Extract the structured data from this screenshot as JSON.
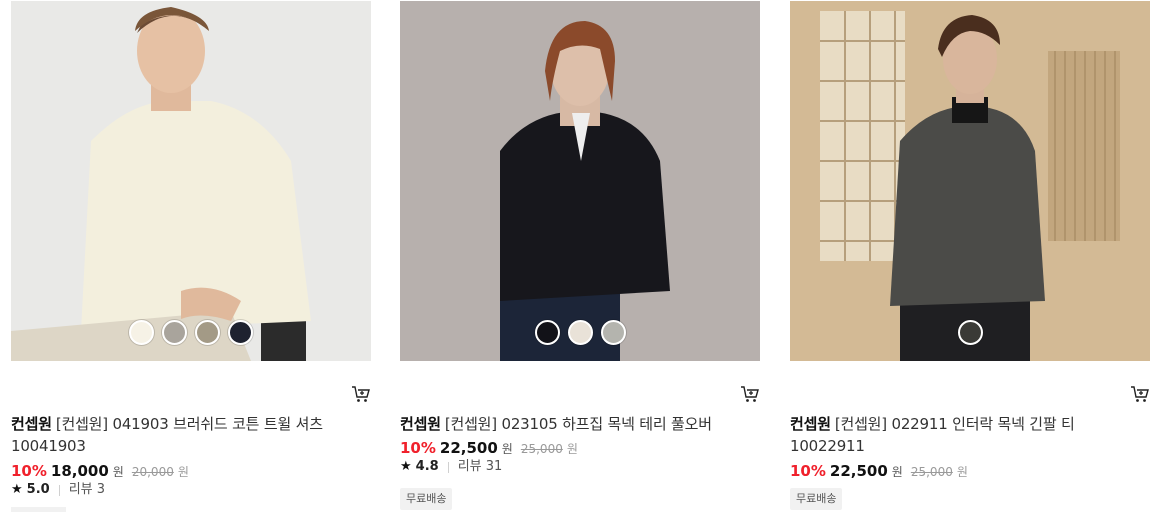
{
  "products": [
    {
      "brand": "컨셉원",
      "name": "[컨셉원] 041903 브러쉬드 코튼 트윌 셔츠 10041903",
      "discount": "10%",
      "price": "18,000",
      "unit": "원",
      "original_price": "20,000",
      "original_unit": "원",
      "rating": "5.0",
      "reviews": "리뷰 3",
      "badge": "",
      "swatches": [
        "#f6f2e6",
        "#a9a49c",
        "#a39a86",
        "#1e2230"
      ]
    },
    {
      "brand": "컨셉원",
      "name": "[컨셉원] 023105 하프집 목넥 테리 풀오버",
      "discount": "10%",
      "price": "22,500",
      "unit": "원",
      "original_price": "25,000",
      "original_unit": "원",
      "rating": "4.8",
      "reviews": "리뷰 31",
      "badge": "무료배송",
      "swatches": [
        "#121218",
        "#e9e2d8",
        "#b4b4ae"
      ]
    },
    {
      "brand": "컨셉원",
      "name": "[컨셉원] 022911 인터락 목넥 긴팔 티 10022911",
      "discount": "10%",
      "price": "22,500",
      "unit": "원",
      "original_price": "25,000",
      "original_unit": "원",
      "rating": "",
      "reviews": "",
      "badge": "무료배송",
      "swatches": [
        "#3a3a36"
      ]
    }
  ],
  "icons": {
    "cart": "cart-icon",
    "star": "star-icon"
  },
  "colors": {
    "discount": "#f0212c",
    "badge_bg": "#f1f1f1"
  }
}
